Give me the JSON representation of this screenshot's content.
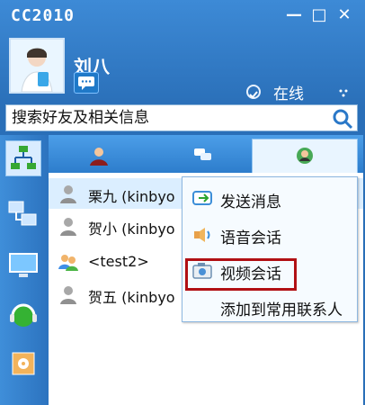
{
  "window": {
    "title": "CC2010"
  },
  "title_buttons": {
    "minimize": "—",
    "restore": "□",
    "close": "✕"
  },
  "profile": {
    "name": "刘八",
    "status": "在线"
  },
  "search": {
    "placeholder": "搜索好友及相关信息"
  },
  "contacts": [
    {
      "label": "栗九 (kinbyo"
    },
    {
      "label": "贺小 (kinbyo"
    },
    {
      "label": "<test2>"
    },
    {
      "label": "贺五 (kinbyo"
    }
  ],
  "context_menu": [
    {
      "label": "发送消息"
    },
    {
      "label": "语音会话"
    },
    {
      "label": "视频会话"
    },
    {
      "label": "添加到常用联系人"
    }
  ]
}
